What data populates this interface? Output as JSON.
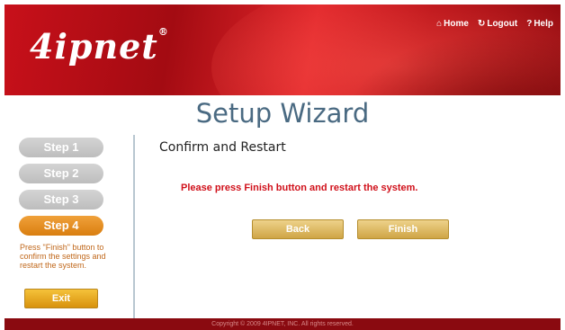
{
  "header": {
    "logo_text": "4ipnet",
    "logo_mark": "®",
    "links": [
      {
        "icon": "home-icon",
        "glyph": "⌂",
        "label": "Home"
      },
      {
        "icon": "logout-icon",
        "glyph": "↻",
        "label": "Logout"
      },
      {
        "icon": "help-icon",
        "glyph": "?",
        "label": "Help"
      }
    ]
  },
  "page_title": "Setup Wizard",
  "steps": [
    "Step 1",
    "Step 2",
    "Step 3",
    "Step 4"
  ],
  "active_step": "Step 4",
  "step_description": "Press \"Finish\" button to confirm the settings and restart the system.",
  "exit_label": "Exit",
  "section_title": "Confirm and Restart",
  "message": "Please press Finish button and restart the system.",
  "buttons": {
    "back": "Back",
    "finish": "Finish"
  },
  "footer": "Copyright © 2009 4IPNET, INC. All rights reserved.",
  "colors": {
    "header_red": "#c8101a",
    "accent_orange": "#e08a18",
    "message_red": "#d0101a",
    "title_blue": "#4a6a82"
  }
}
